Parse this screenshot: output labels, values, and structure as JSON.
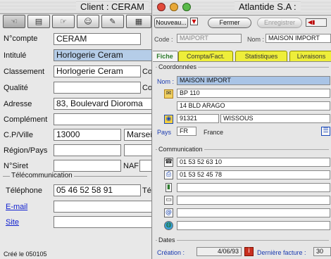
{
  "left_window": {
    "title": "Client : CERAM",
    "fields": {
      "numero_label": "N°compte",
      "numero": "CERAM",
      "intitule_label": "Intitulé",
      "intitule": "Horlogerie Ceram",
      "classement_label": "Classement",
      "classement": "Horlogerie Ceram",
      "classement_cut": "Co",
      "qualite_label": "Qualité",
      "qualite_cut": "Co",
      "adresse_label": "Adresse",
      "adresse": "83, Boulevard Dioroma",
      "complement_label": "Complément",
      "cpville_label": "C.P/Ville",
      "cp": "13000",
      "ville": "Marsei",
      "region_label": "Région/Pays",
      "siret_label": "N°Siret",
      "naf_label": "NAF",
      "telecom_header": "Télécommunication",
      "telephone_label": "Téléphone",
      "telephone": "05 46 52 58 91",
      "telephone_cut": "Té",
      "email_label": "E-mail",
      "site_label": "Site",
      "cree": "Créé le 050105"
    }
  },
  "right_window": {
    "title": "Atlantide S.A :",
    "buttons": {
      "nouveau": "Nouveau...",
      "fermer": "Fermer",
      "enregistrer": "Enregistrer"
    },
    "code_label": "Code :",
    "code": "MAIPORT",
    "nom_label": "Nom :",
    "nom": "MAISON IMPORT",
    "tabs": [
      "Fiche",
      "Compta/Fact.",
      "Statistiques",
      "Livraisons"
    ],
    "coordonnees": {
      "header": "Coordonnées",
      "nom_label": "Nom :",
      "nom": "MAISON IMPORT",
      "adresse1": "BP 110",
      "adresse2": "14 BLD ARAGO",
      "cp": "91321",
      "ville": "WISSOUS",
      "pays_label": "Pays",
      "pays_code": "FR",
      "pays": "France"
    },
    "communication": {
      "header": "Communication",
      "tel": "01 53 52 63 10",
      "fax": "01 53 52 45 78"
    },
    "dates": {
      "header": "Dates",
      "creation_label": "Création :",
      "creation": "4/06/93",
      "derniere_label": "Dernière facture :",
      "derniere": "30"
    }
  }
}
